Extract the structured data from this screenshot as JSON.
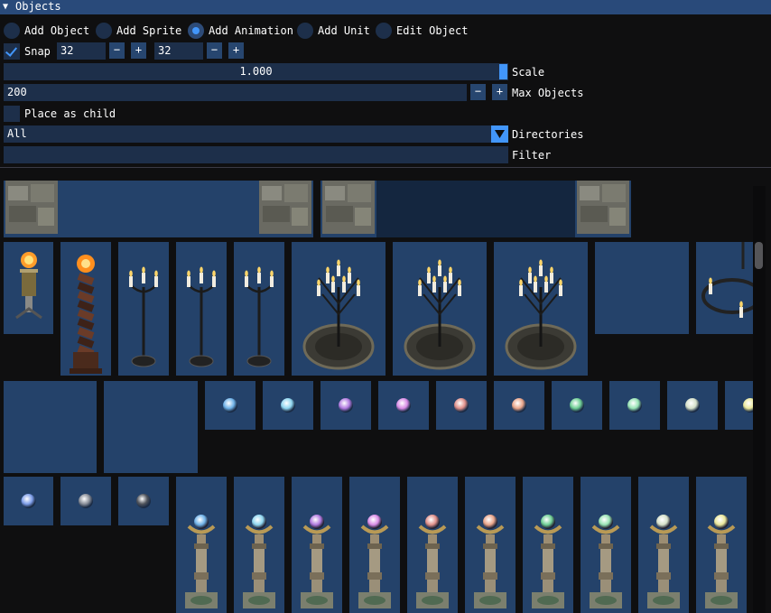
{
  "window": {
    "title": "Objects",
    "collapse_icon": "triangle-down-icon"
  },
  "modes": [
    {
      "label": "Add Object",
      "selected": false
    },
    {
      "label": "Add Sprite",
      "selected": false
    },
    {
      "label": "Add Animation",
      "selected": true
    },
    {
      "label": "Add Unit",
      "selected": false
    },
    {
      "label": "Edit Object",
      "selected": false
    }
  ],
  "snap": {
    "label": "Snap",
    "checked": true,
    "x": "32",
    "y": "32",
    "minus": "−",
    "plus": "+"
  },
  "scale": {
    "value": "1.000",
    "label": "Scale",
    "fraction": 1.0
  },
  "max_objects": {
    "value": "200",
    "label": "Max Objects",
    "minus": "−",
    "plus": "+"
  },
  "place_as_child": {
    "label": "Place as child",
    "checked": false
  },
  "directories": {
    "value": "All",
    "label": "Directories",
    "dropdown_icon": "triangle-down-icon"
  },
  "filter": {
    "value": "",
    "label": "Filter"
  },
  "colors": {
    "title_bar": "#294a7a",
    "frame_bg": "#1d2f4a",
    "button_bg": "#27466f",
    "accent": "#4296fa",
    "tile_bg": "#24426a",
    "window_bg": "#0f0f10"
  },
  "palette_items": [
    "stone-wall-sprite",
    "stone-wall-dark-sprite",
    "brazier-sprite",
    "twisted-torch-pillar-sprite",
    "candelabra-sprite",
    "candelabra-sprite",
    "candelabra-sprite",
    "candle-tree-sprite",
    "candle-tree-sprite",
    "candle-tree-sprite",
    "empty-tile",
    "chandelier-sprite",
    "empty-tile",
    "empty-tile",
    "blue-orb-sprite",
    "cyan-orb-sprite",
    "purple-orb-sprite",
    "magenta-orb-sprite",
    "orange-orb-sprite",
    "peach-orb-sprite",
    "green-orb-sprite",
    "mint-orb-sprite",
    "white-orb-sprite",
    "yellow-orb-sprite",
    "blue-orb-sprite",
    "grey-orb-sprite",
    "dark-orb-sprite",
    "orb-pedestal-sprite",
    "orb-pedestal-sprite",
    "orb-pedestal-sprite",
    "orb-pedestal-sprite",
    "orb-pedestal-sprite",
    "orb-pedestal-sprite",
    "orb-pedestal-sprite",
    "orb-pedestal-sprite",
    "orb-pedestal-sprite",
    "orb-pedestal-sprite"
  ],
  "orb_colors": [
    "#6fb2e8",
    "#8fd6f0",
    "#b17ae0",
    "#d98ce6",
    "#e0908a",
    "#e9a58a",
    "#6fcf95",
    "#97e3b4",
    "#d5e0c9",
    "#eae79a"
  ]
}
